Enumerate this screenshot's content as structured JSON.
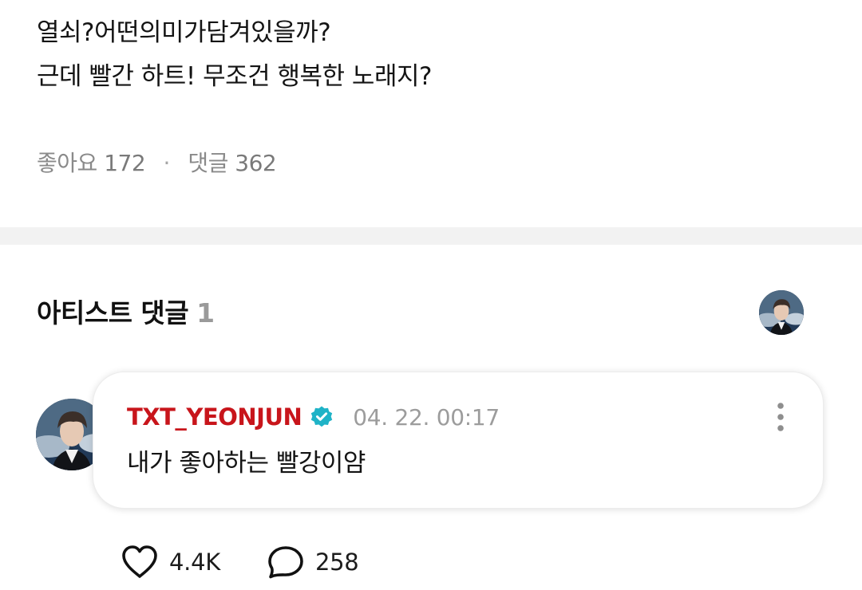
{
  "post": {
    "lines": [
      "열쇠?어떤의미가담겨있을까?",
      "근데 빨간 하트! 무조건 행복한 노래지?"
    ],
    "likes_label": "좋아요",
    "likes_count": "172",
    "separator": "·",
    "comments_label": "댓글",
    "comments_count": "362"
  },
  "artist_comments": {
    "title": "아티스트 댓글",
    "count": "1",
    "comment": {
      "author": "TXT_YEONJUN",
      "verified": true,
      "timestamp": "04. 22. 00:17",
      "text": "내가 좋아하는 빨강이얌",
      "like_count": "4.4K",
      "reply_count": "258"
    }
  },
  "colors": {
    "author_name": "#c8151b",
    "verified_badge": "#1fb3c7",
    "divider": "#f2f2f2",
    "muted_text": "#8a8a8a"
  },
  "icons": {
    "verified": "verified-badge-icon",
    "more": "more-vertical-icon",
    "like": "heart-outline-icon",
    "reply": "speech-bubble-icon"
  }
}
